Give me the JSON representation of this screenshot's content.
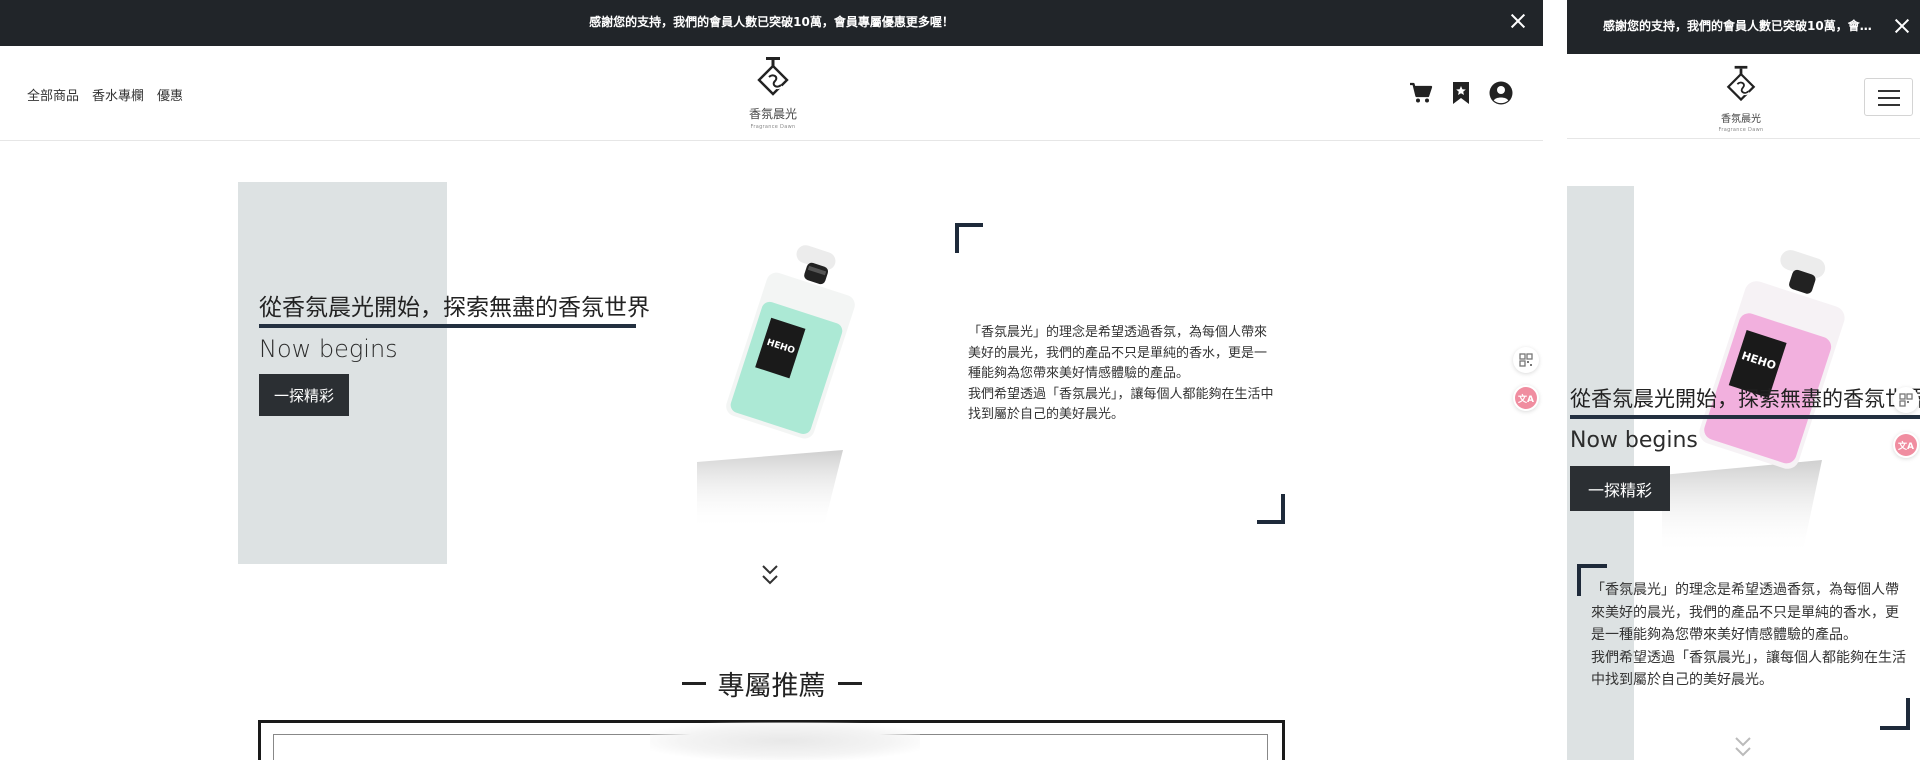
{
  "announcement": {
    "text": "感謝您的支持，我們的會員人數已突破10萬，會員專屬優惠更多喔！"
  },
  "nav": {
    "links": [
      "全部商品",
      "香水專欄",
      "優惠"
    ]
  },
  "logo": {
    "name": "香氛晨光",
    "tagline": "Fragrance Dawn"
  },
  "hero": {
    "title": "從香氛晨光開始，探索無盡的香氛世界",
    "subtitle": "Now begins",
    "cta": "一探精彩",
    "bottle_label": "HEHO",
    "description": "「香氛晨光」的理念是希望透過香氛，為每個人帶來美好的晨光，我們的產品不只是單純的香水，更是一種能夠為您帶來美好情感體驗的產品。",
    "description2": "我們希望透過「香氛晨光」，讓每個人都能夠在生活中找到屬於自己的美好晨光。"
  },
  "floating": {
    "translate_label": "文A"
  },
  "section": {
    "title": "專屬推薦"
  },
  "colors": {
    "dark": "#212529",
    "panel": "#dde2e3",
    "accent_navy": "#233040",
    "mint": "#8fe3c8",
    "pink": "#f2a8dc"
  },
  "icons": [
    "cart-icon",
    "bookmark-icon",
    "user-circle-icon",
    "close-icon",
    "chevron-double-down-icon",
    "qr-grid-icon",
    "translate-icon",
    "hamburger-menu-icon"
  ]
}
